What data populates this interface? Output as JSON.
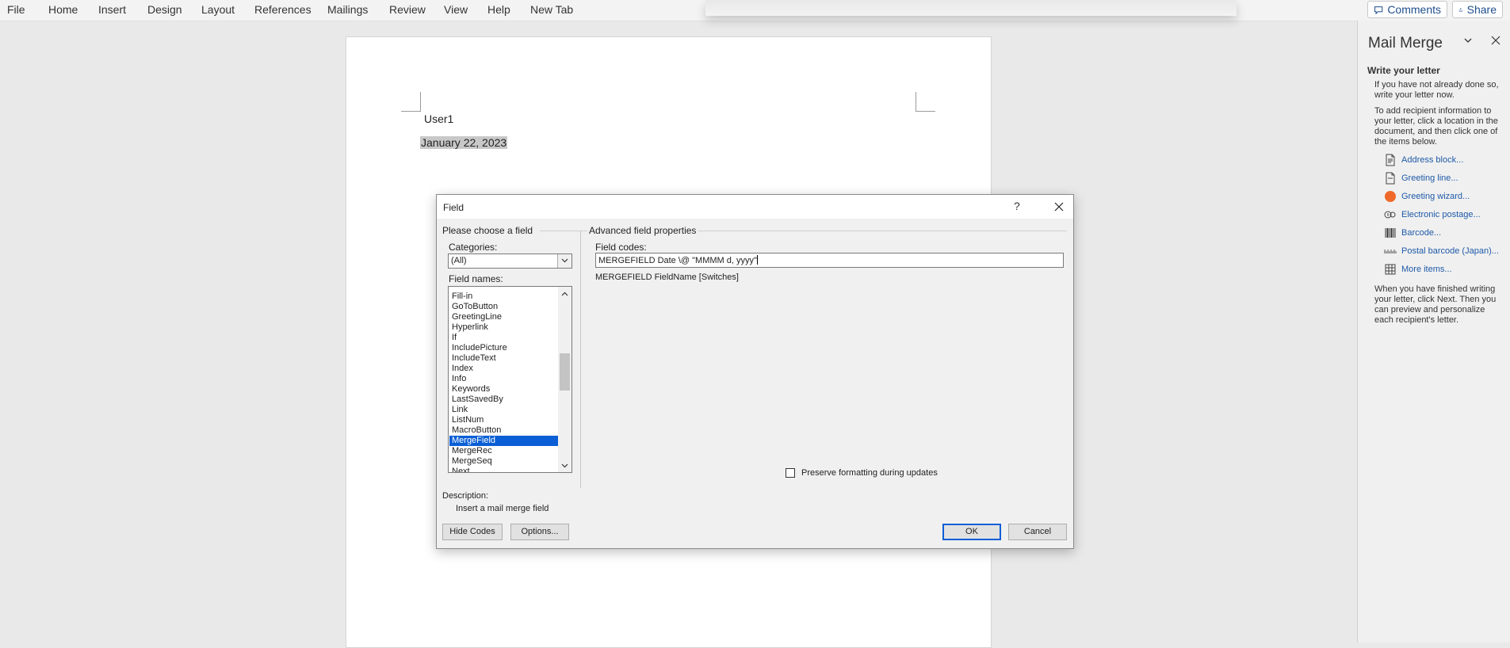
{
  "menu": {
    "tabs": [
      "File",
      "Home",
      "Insert",
      "Design",
      "Layout",
      "References",
      "Mailings",
      "Review",
      "View",
      "Help",
      "New Tab"
    ],
    "comments": "Comments",
    "share": "Share"
  },
  "document": {
    "line1": "User1",
    "line2": "January 22, 2023"
  },
  "dialog": {
    "title": "Field",
    "help": "?",
    "left_group": "Please choose a field",
    "categories_label": "Categories:",
    "categories_value": "(All)",
    "field_names_label": "Field names:",
    "field_names": [
      "Fill-in",
      "GoToButton",
      "GreetingLine",
      "Hyperlink",
      "If",
      "IncludePicture",
      "IncludeText",
      "Index",
      "Info",
      "Keywords",
      "LastSavedBy",
      "Link",
      "ListNum",
      "MacroButton",
      "MergeField",
      "MergeRec",
      "MergeSeq",
      "Next"
    ],
    "selected": "MergeField",
    "right_group": "Advanced field properties",
    "field_codes_label": "Field codes:",
    "field_codes_value": "MERGEFIELD  Date \\@ \"MMMM d, yyyy\"",
    "syntax": "MERGEFIELD FieldName [Switches]",
    "preserve_label": "Preserve formatting during updates",
    "preserve_checked": false,
    "description_label": "Description:",
    "description_text": "Insert a mail merge field",
    "hide_codes": "Hide Codes",
    "options": "Options...",
    "ok": "OK",
    "cancel": "Cancel"
  },
  "pane": {
    "title": "Mail Merge",
    "heading": "Write your letter",
    "intro1": "If you have not already done so, write your letter now.",
    "intro2": "To add recipient information to your letter, click a location in the document, and then click one of the items below.",
    "items": [
      {
        "label": "Address block...",
        "icon": "address-block-icon"
      },
      {
        "label": "Greeting line...",
        "icon": "greeting-line-icon"
      },
      {
        "label": "Greeting wizard...",
        "icon": "greeting-wizard-icon"
      },
      {
        "label": "Electronic postage...",
        "icon": "electronic-postage-icon"
      },
      {
        "label": "Barcode...",
        "icon": "barcode-icon"
      },
      {
        "label": "Postal barcode (Japan)...",
        "icon": "postal-barcode-icon"
      },
      {
        "label": "More items...",
        "icon": "more-items-icon"
      }
    ],
    "outro": "When you have finished writing your letter, click Next. Then you can preview and personalize each recipient's letter.",
    "accent": "#f0692a"
  }
}
